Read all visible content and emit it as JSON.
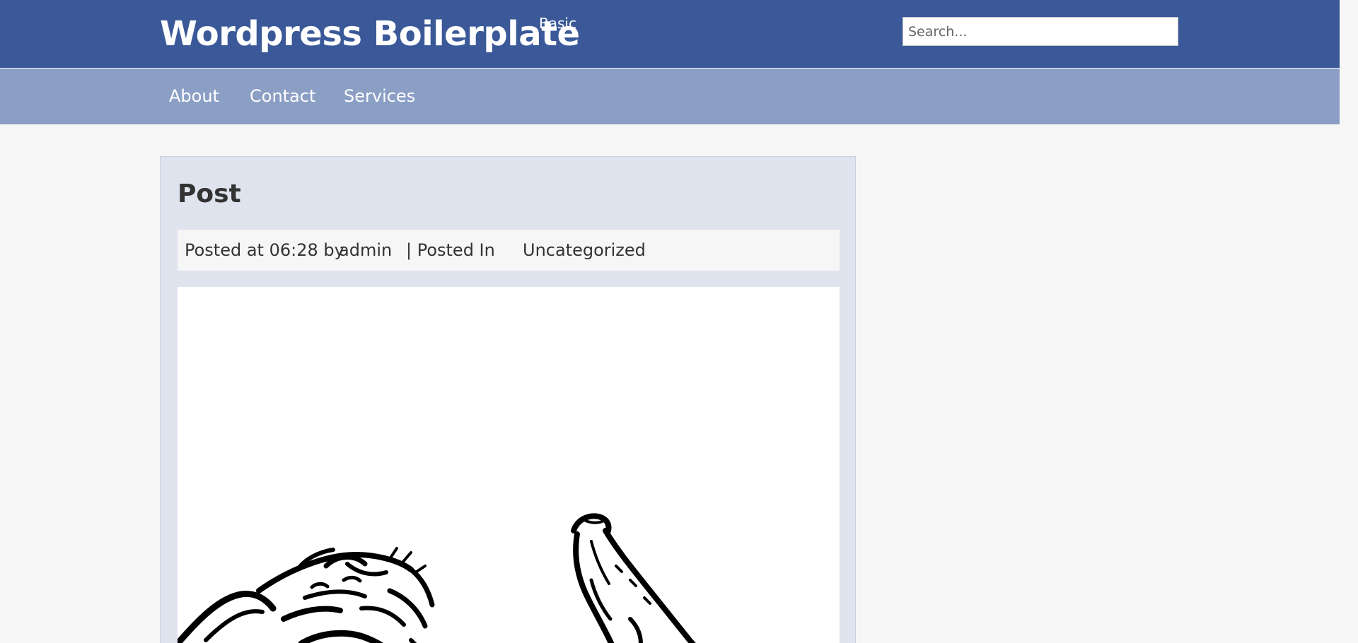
{
  "header": {
    "site_title": "Wordpress Boilerplate",
    "tagline": "Basic",
    "search_placeholder": "Search...",
    "background_color": "#3b5998"
  },
  "nav": {
    "background_color": "#8b9fc5",
    "items": [
      {
        "label": "About"
      },
      {
        "label": "Contact"
      },
      {
        "label": "Services"
      }
    ]
  },
  "post": {
    "title": "Post",
    "meta": {
      "posted_at_text": "Posted at 06:28 by",
      "author": "admin",
      "posted_in_text": "| Posted In",
      "category": "Uncategorized"
    },
    "image_icon": "line-art-illustration"
  }
}
